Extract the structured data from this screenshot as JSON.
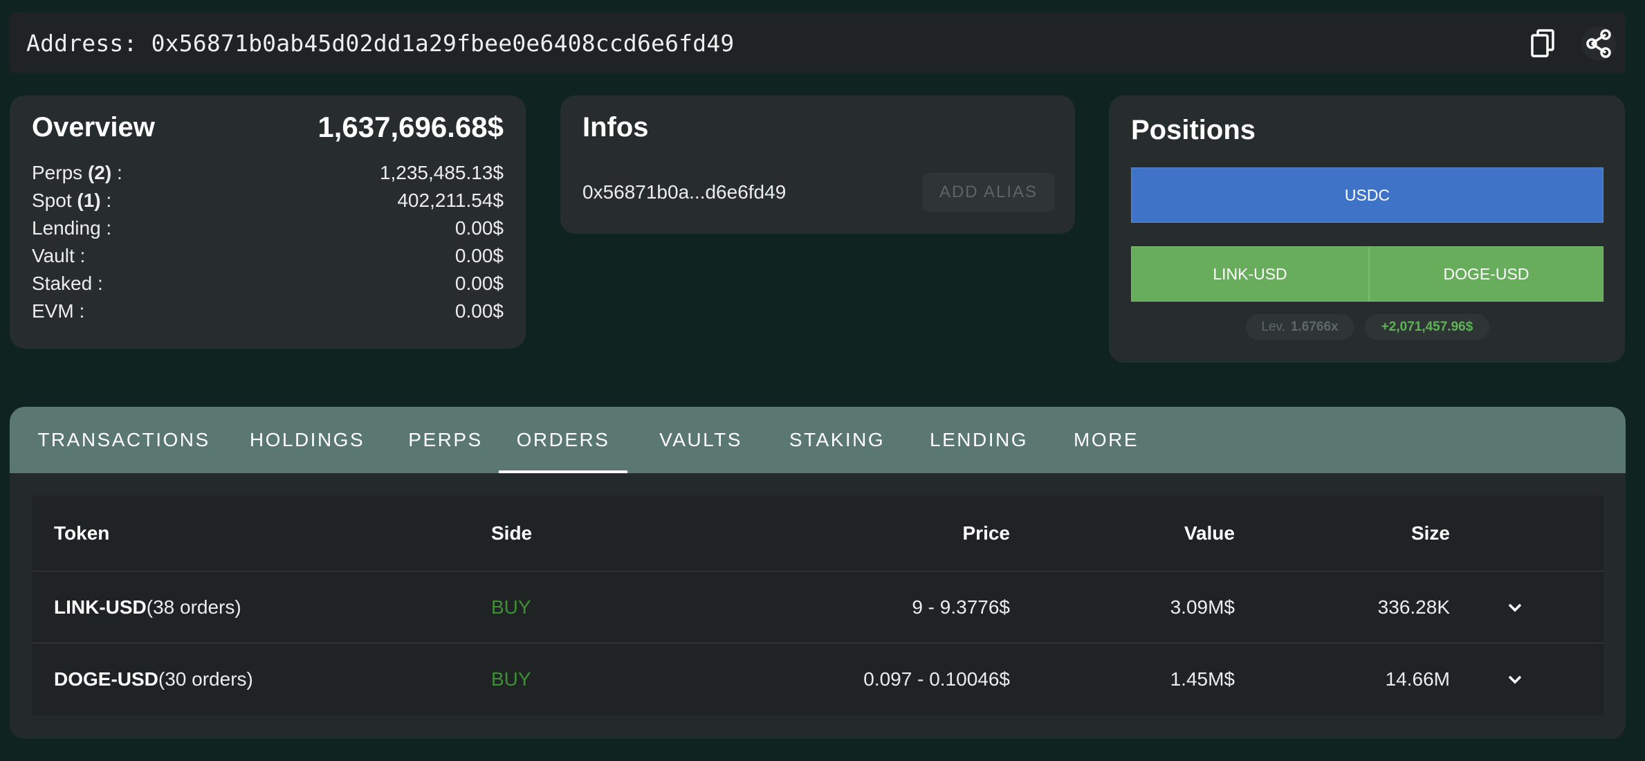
{
  "address_bar": {
    "text": "Address: 0x56871b0ab45d02dd1a29fbee0e6408ccd6e6fd49",
    "copy_icon": "copy-icon",
    "share_icon": "share-icon"
  },
  "overview": {
    "title": "Overview",
    "total": "1,637,696.68$",
    "rows": [
      {
        "label_pre": "Perps ",
        "count": "(2)",
        "label_post": " :",
        "value": "1,235,485.13$"
      },
      {
        "label_pre": "Spot ",
        "count": "(1)",
        "label_post": " :",
        "value": "402,211.54$"
      },
      {
        "label_pre": "Lending :",
        "count": "",
        "label_post": "",
        "value": "0.00$"
      },
      {
        "label_pre": "Vault :",
        "count": "",
        "label_post": "",
        "value": "0.00$"
      },
      {
        "label_pre": "Staked :",
        "count": "",
        "label_post": "",
        "value": "0.00$"
      },
      {
        "label_pre": "EVM :",
        "count": "",
        "label_post": "",
        "value": "0.00$"
      }
    ]
  },
  "infos": {
    "title": "Infos",
    "short_address": "0x56871b0a...d6e6fd49",
    "add_alias": "ADD ALIAS"
  },
  "positions": {
    "title": "Positions",
    "spot_bar": "USDC",
    "perp_bars": [
      "LINK-USD",
      "DOGE-USD"
    ],
    "leverage_label": "Lev.",
    "leverage_value": "1.6766x",
    "pnl": "+2,071,457.96$"
  },
  "tabs": {
    "items": [
      "TRANSACTIONS",
      "HOLDINGS",
      "PERPS",
      "ORDERS",
      "VAULTS",
      "STAKING",
      "LENDING",
      "MORE"
    ],
    "active": "ORDERS"
  },
  "orders_table": {
    "headers": {
      "token": "Token",
      "side": "Side",
      "price": "Price",
      "value": "Value",
      "size": "Size"
    },
    "rows": [
      {
        "token": "LINK-USD",
        "orders": "(38 orders)",
        "side": "BUY",
        "price": "9 - 9.3776$",
        "value": "3.09M$",
        "size": "336.28K"
      },
      {
        "token": "DOGE-USD",
        "orders": "(30 orders)",
        "side": "BUY",
        "price": "0.097 - 0.10046$",
        "value": "1.45M$",
        "size": "14.66M"
      }
    ]
  },
  "colors": {
    "background": "#0f2420",
    "card": "#272c2c",
    "tab_bar": "#5a7770",
    "usdc_bar": "#3e73c8",
    "perp_bar": "#67ad5b",
    "buy": "#3f8d36",
    "pnl": "#5db356"
  }
}
